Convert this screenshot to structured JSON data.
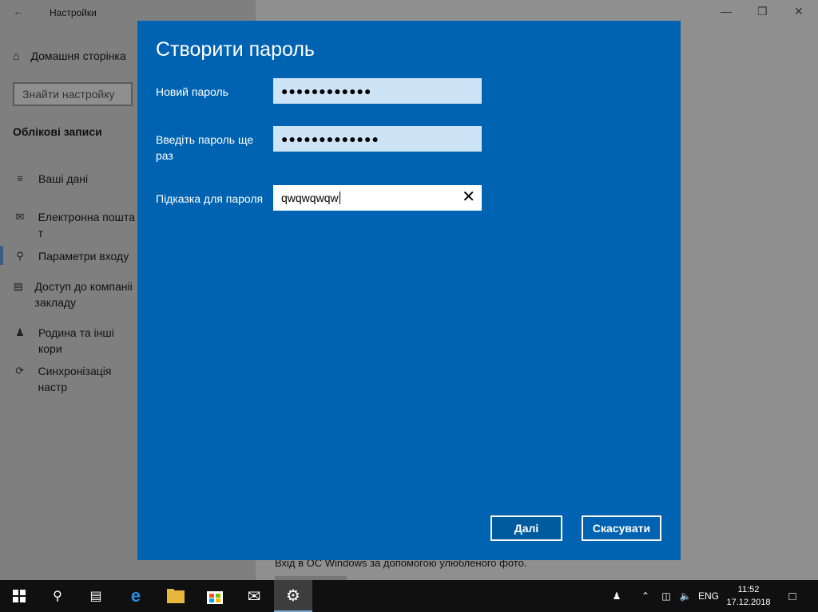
{
  "window": {
    "title": "Настройки",
    "home_label": "Домашня сторінка",
    "search_placeholder": "Знайти настройку",
    "section_title": "Облікові записи",
    "nav": [
      {
        "label": "Ваші дані",
        "icon": "person-card-icon"
      },
      {
        "label": "Електронна пошта т",
        "icon": "mail-icon"
      },
      {
        "label": "Параметри входу",
        "icon": "key-icon"
      },
      {
        "label": "Доступ до компаніі закладу",
        "icon": "briefcase-icon"
      },
      {
        "label": "Родина та інші кори",
        "icon": "people-icon"
      },
      {
        "label": "Синхронізація настр",
        "icon": "sync-icon"
      }
    ],
    "bottom_text": "Вхід в ОС Windows за допомогою улюбленого фото."
  },
  "dialog": {
    "title": "Створити пароль",
    "new_password_label": "Новий пароль",
    "new_password_mask": "●●●●●●●●●●●●",
    "confirm_label": "Введіть пароль ще раз",
    "confirm_mask": "●●●●●●●●●●●●●",
    "hint_label": "Підказка для пароля",
    "hint_value": "qwqwqwqw",
    "next_button": "Далі",
    "cancel_button": "Скасувати"
  },
  "taskbar": {
    "language": "ENG",
    "time": "11:52",
    "date": "17.12.2018"
  }
}
